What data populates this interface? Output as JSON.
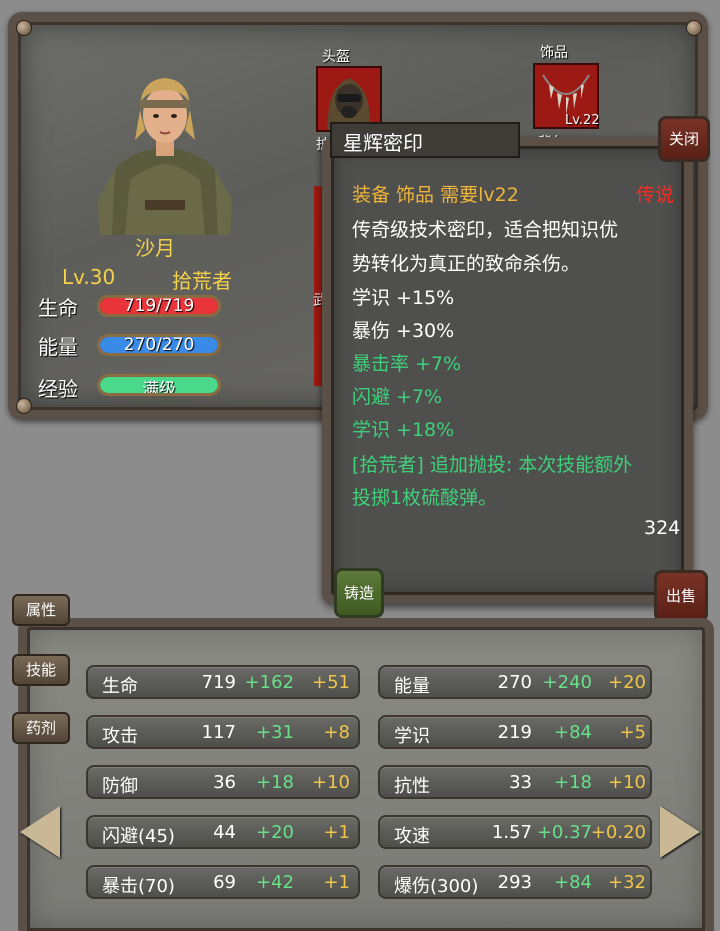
{
  "character": {
    "name": "沙月",
    "level": "Lv.30",
    "class": "拾荒者",
    "hp_label": "生命",
    "hp_value": "719/719",
    "hp_fraction": 1.0,
    "energy_label": "能量",
    "energy_value": "270/270",
    "energy_fraction": 1.0,
    "exp_label": "经验",
    "exp_value": "满级",
    "exp_fraction": 1.0
  },
  "equipment_slots": {
    "helmet_label": "头盔",
    "accessory_label": "饰品",
    "accessory_level": "Lv.22",
    "partial_label_1": "护",
    "partial_label_2": "背包",
    "partial_label_3": "武"
  },
  "tooltip": {
    "title": "星辉密印",
    "type_line": "装备 饰品 需要lv22",
    "rarity": "传说",
    "description_1": "传奇级技术密印，适合把知识优",
    "description_2": "势转化为真正的致命杀伤。",
    "stats": [
      {
        "text": "学识 +15%",
        "color": "white"
      },
      {
        "text": "暴伤 +30%",
        "color": "white"
      },
      {
        "text": "暴击率 +7%",
        "color": "green"
      },
      {
        "text": "闪避 +7%",
        "color": "green"
      },
      {
        "text": "学识 +18%",
        "color": "green"
      }
    ],
    "special_1": "[拾荒者] 追加抛投: 本次技能额外",
    "special_2": "投掷1枚硫酸弹。",
    "price": "324",
    "close_label": "关闭",
    "forge_label": "铸造",
    "sell_label": "出售"
  },
  "side_tabs": [
    "属性",
    "技能",
    "药剂"
  ],
  "stats_table": [
    {
      "name": "生命",
      "base": "719",
      "bonus1": "+162",
      "bonus2": "+51"
    },
    {
      "name": "能量",
      "base": "270",
      "bonus1": "+240",
      "bonus2": "+20"
    },
    {
      "name": "攻击",
      "base": "117",
      "bonus1": "+31",
      "bonus2": "+8"
    },
    {
      "name": "学识",
      "base": "219",
      "bonus1": "+84",
      "bonus2": "+5"
    },
    {
      "name": "防御",
      "base": "36",
      "bonus1": "+18",
      "bonus2": "+10"
    },
    {
      "name": "抗性",
      "base": "33",
      "bonus1": "+18",
      "bonus2": "+10"
    },
    {
      "name": "闪避(45)",
      "base": "44",
      "bonus1": "+20",
      "bonus2": "+1"
    },
    {
      "name": "攻速",
      "base": "1.57",
      "bonus1": "+0.37",
      "bonus2": "+0.20"
    },
    {
      "name": "暴击(70)",
      "base": "69",
      "bonus1": "+42",
      "bonus2": "+1"
    },
    {
      "name": "爆伤(300)",
      "base": "293",
      "bonus1": "+84",
      "bonus2": "+32"
    }
  ],
  "colors": {
    "hp_bar": "#e8343a",
    "energy_bar": "#3a8ae8",
    "exp_bar": "#4ad88a",
    "gold_text": "#f5d24a",
    "legend_red": "#ff2a22"
  }
}
